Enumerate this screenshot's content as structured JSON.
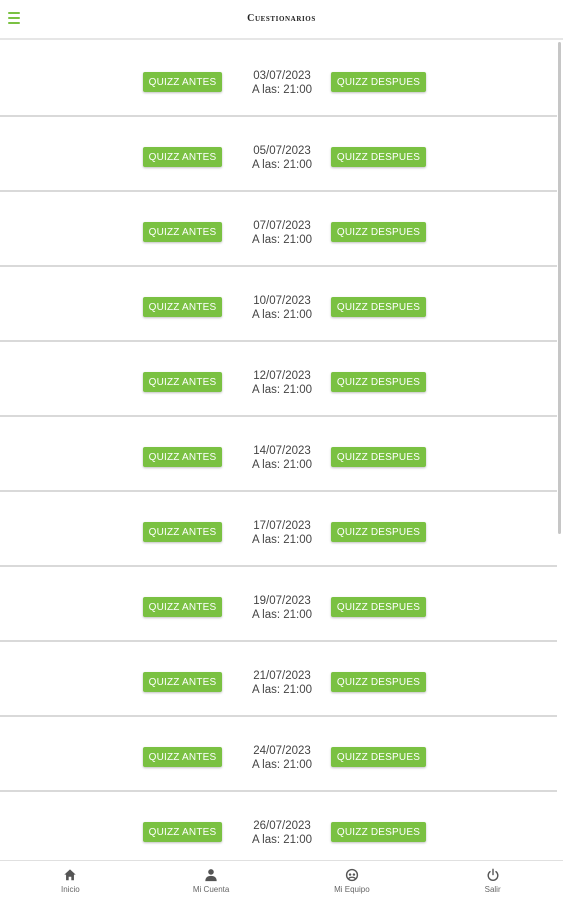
{
  "header": {
    "title": "Cuestionarios",
    "menu_icon": "hamburger-icon"
  },
  "colors": {
    "accent": "#7ac142",
    "divider": "#d9d9d9"
  },
  "quizzes": [
    {
      "antes": "QUIZZ ANTES",
      "date": "03/07/2023",
      "time": "A las: 21:00",
      "despues": "QUIZZ DESPUES"
    },
    {
      "antes": "QUIZZ ANTES",
      "date": "05/07/2023",
      "time": "A las: 21:00",
      "despues": "QUIZZ DESPUES"
    },
    {
      "antes": "QUIZZ ANTES",
      "date": "07/07/2023",
      "time": "A las: 21:00",
      "despues": "QUIZZ DESPUES"
    },
    {
      "antes": "QUIZZ ANTES",
      "date": "10/07/2023",
      "time": "A las: 21:00",
      "despues": "QUIZZ DESPUES"
    },
    {
      "antes": "QUIZZ ANTES",
      "date": "12/07/2023",
      "time": "A las: 21:00",
      "despues": "QUIZZ DESPUES"
    },
    {
      "antes": "QUIZZ ANTES",
      "date": "14/07/2023",
      "time": "A las: 21:00",
      "despues": "QUIZZ DESPUES"
    },
    {
      "antes": "QUIZZ ANTES",
      "date": "17/07/2023",
      "time": "A las: 21:00",
      "despues": "QUIZZ DESPUES"
    },
    {
      "antes": "QUIZZ ANTES",
      "date": "19/07/2023",
      "time": "A las: 21:00",
      "despues": "QUIZZ DESPUES"
    },
    {
      "antes": "QUIZZ ANTES",
      "date": "21/07/2023",
      "time": "A las: 21:00",
      "despues": "QUIZZ DESPUES"
    },
    {
      "antes": "QUIZZ ANTES",
      "date": "24/07/2023",
      "time": "A las: 21:00",
      "despues": "QUIZZ DESPUES"
    },
    {
      "antes": "QUIZZ ANTES",
      "date": "26/07/2023",
      "time": "A las: 21:00",
      "despues": "QUIZZ DESPUES"
    }
  ],
  "bottom_nav": [
    {
      "label": "Inicio",
      "icon": "home-icon"
    },
    {
      "label": "Mi Cuenta",
      "icon": "user-icon"
    },
    {
      "label": "Mi Equipo",
      "icon": "team-icon"
    },
    {
      "label": "Salir",
      "icon": "power-icon"
    }
  ]
}
